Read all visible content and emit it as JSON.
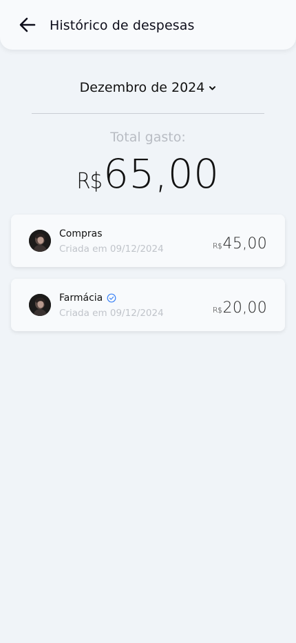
{
  "header": {
    "title": "Histórico de despesas",
    "back_icon": "arrow-left-icon"
  },
  "month_selector": {
    "label": "Dezembro de 2024",
    "icon": "chevron-down-icon"
  },
  "total": {
    "label": "Total gasto:",
    "currency": "R$",
    "value": "65,00"
  },
  "expenses": [
    {
      "title": "Compras",
      "date": "Criada em 09/12/2024",
      "currency": "R$",
      "value": "45,00",
      "verified": false
    },
    {
      "title": "Farmácia",
      "date": "Criada em 09/12/2024",
      "currency": "R$",
      "value": "20,00",
      "verified": true
    }
  ],
  "colors": {
    "background": "#f0f4f8",
    "card": "#f8fafc",
    "muted_text": "#c0c4ca",
    "verified_icon": "#3b82f6"
  }
}
